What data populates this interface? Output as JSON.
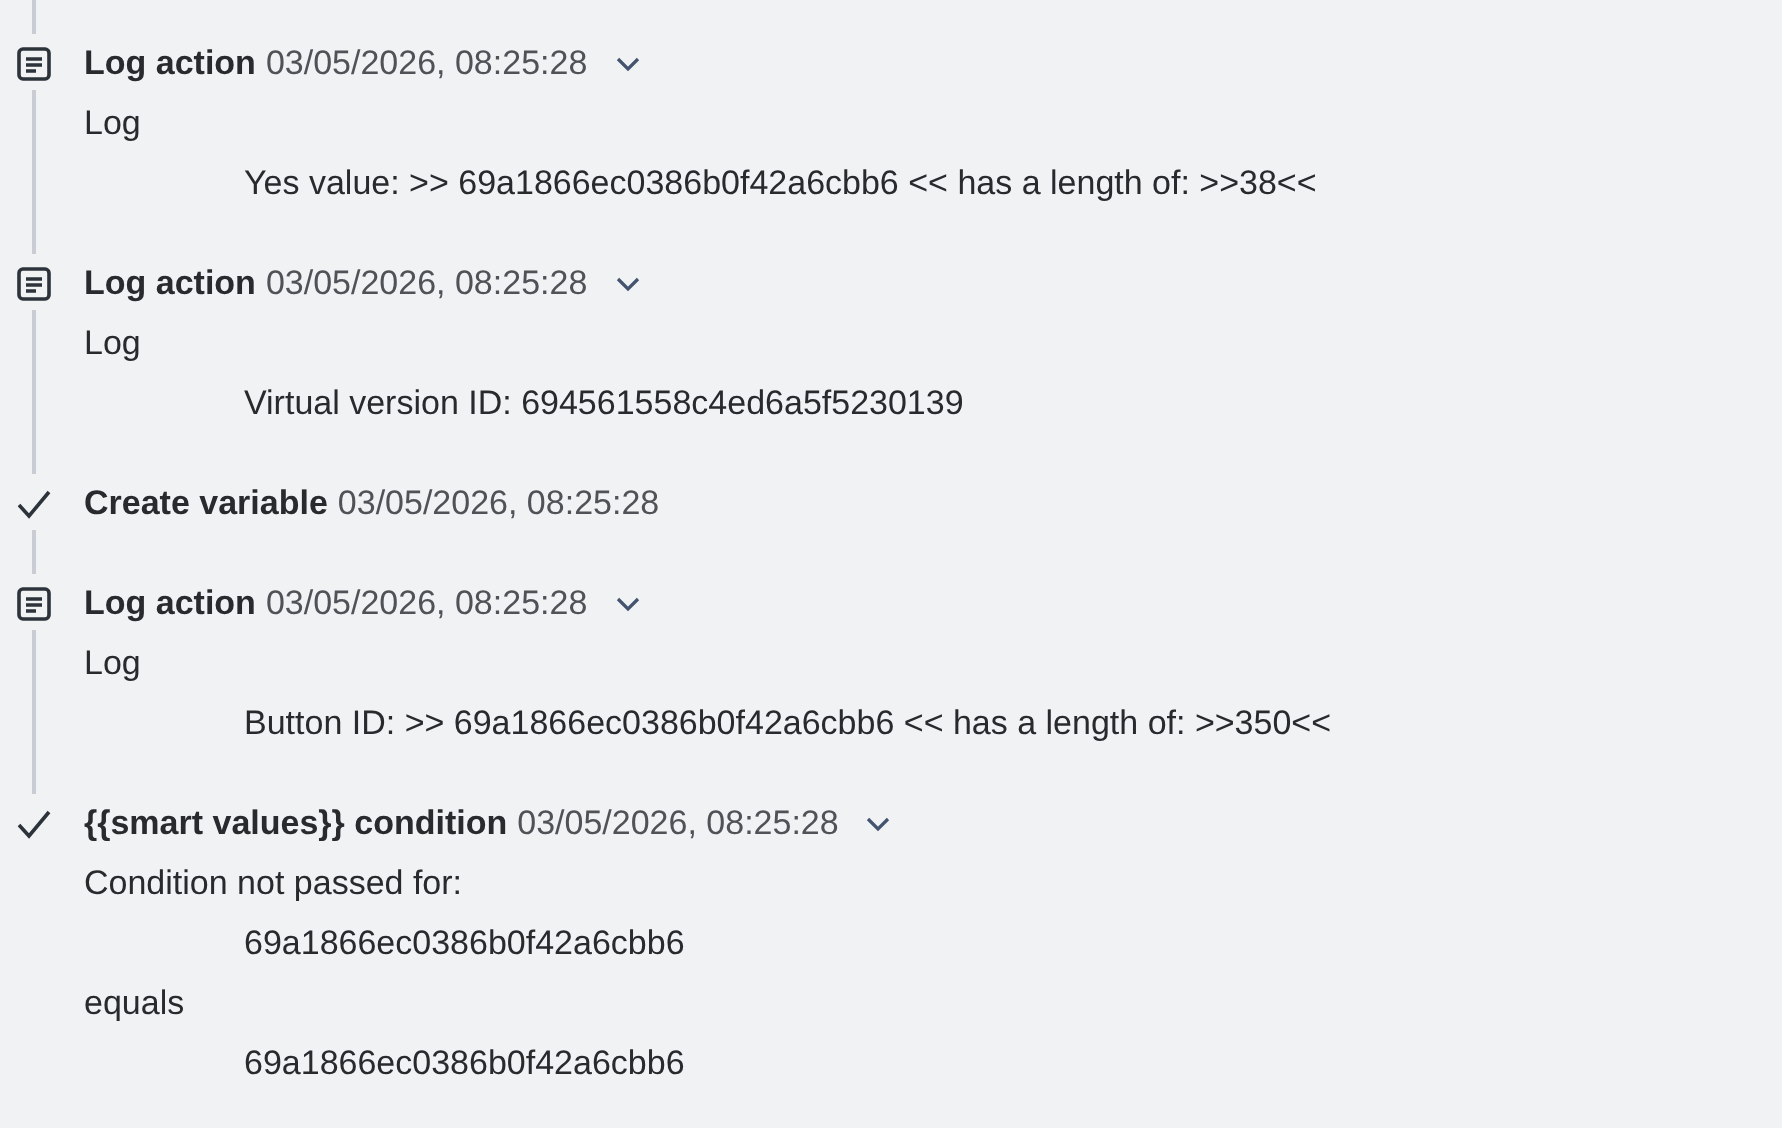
{
  "entries": [
    {
      "kind": "log",
      "title": "Log action",
      "time": "03/05/2026, 08:25:28",
      "expandable": true,
      "lines": [
        {
          "kind": "label",
          "text": "Log"
        },
        {
          "kind": "value",
          "text": "Yes value: >> 69a1866ec0386b0f42a6cbb6 << has a length of: >>38<<"
        }
      ]
    },
    {
      "kind": "log",
      "title": "Log action",
      "time": "03/05/2026, 08:25:28",
      "expandable": true,
      "lines": [
        {
          "kind": "label",
          "text": "Log"
        },
        {
          "kind": "value",
          "text": "Virtual version ID: 694561558c4ed6a5f5230139"
        }
      ]
    },
    {
      "kind": "success",
      "title": "Create variable",
      "time": "03/05/2026, 08:25:28",
      "expandable": false
    },
    {
      "kind": "log",
      "title": "Log action",
      "time": "03/05/2026, 08:25:28",
      "expandable": true,
      "lines": [
        {
          "kind": "label",
          "text": "Log"
        },
        {
          "kind": "value",
          "text": "Button ID: >> 69a1866ec0386b0f42a6cbb6 << has a length of: >>350<<"
        }
      ]
    },
    {
      "kind": "success",
      "title": "{{smart values}} condition",
      "time": "03/05/2026, 08:25:28",
      "expandable": true,
      "lines": [
        {
          "kind": "label",
          "text": "Condition not passed for:"
        },
        {
          "kind": "value",
          "text": "69a1866ec0386b0f42a6cbb6"
        },
        {
          "kind": "label",
          "text": "equals"
        },
        {
          "kind": "value",
          "text": "69a1866ec0386b0f42a6cbb6"
        }
      ]
    }
  ]
}
